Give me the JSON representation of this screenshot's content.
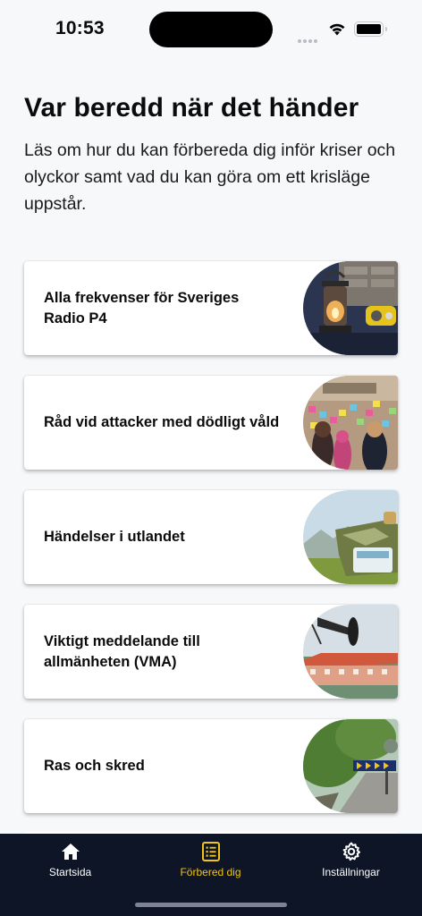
{
  "status_bar": {
    "time": "10:53"
  },
  "header": {
    "title": "Var beredd när det händer",
    "intro": "Läs om hur du kan förbereda dig inför kriser och olyckor samt vad du kan göra om ett krisläge uppstår."
  },
  "cards": [
    {
      "label": "Alla frekvenser för Sveriges Radio P4",
      "image": "lantern-and-radio-photo"
    },
    {
      "label": "Råd vid attacker med dödligt våld",
      "image": "memorial-notes-wall-photo"
    },
    {
      "label": "Händelser i utlandet",
      "image": "travel-backpack-photo"
    },
    {
      "label": "Viktigt meddelande till allmänheten (VMA)",
      "image": "warning-siren-photo"
    },
    {
      "label": "Ras och skred",
      "image": "landslide-road-sign-photo"
    }
  ],
  "tab_bar": {
    "tabs": [
      {
        "label": "Startsida",
        "icon": "home-icon"
      },
      {
        "label": "Förbered dig",
        "icon": "checklist-icon",
        "active": true
      },
      {
        "label": "Inställningar",
        "icon": "gear-icon"
      }
    ],
    "active_color": "#f2c417",
    "background": "#0d1526"
  }
}
